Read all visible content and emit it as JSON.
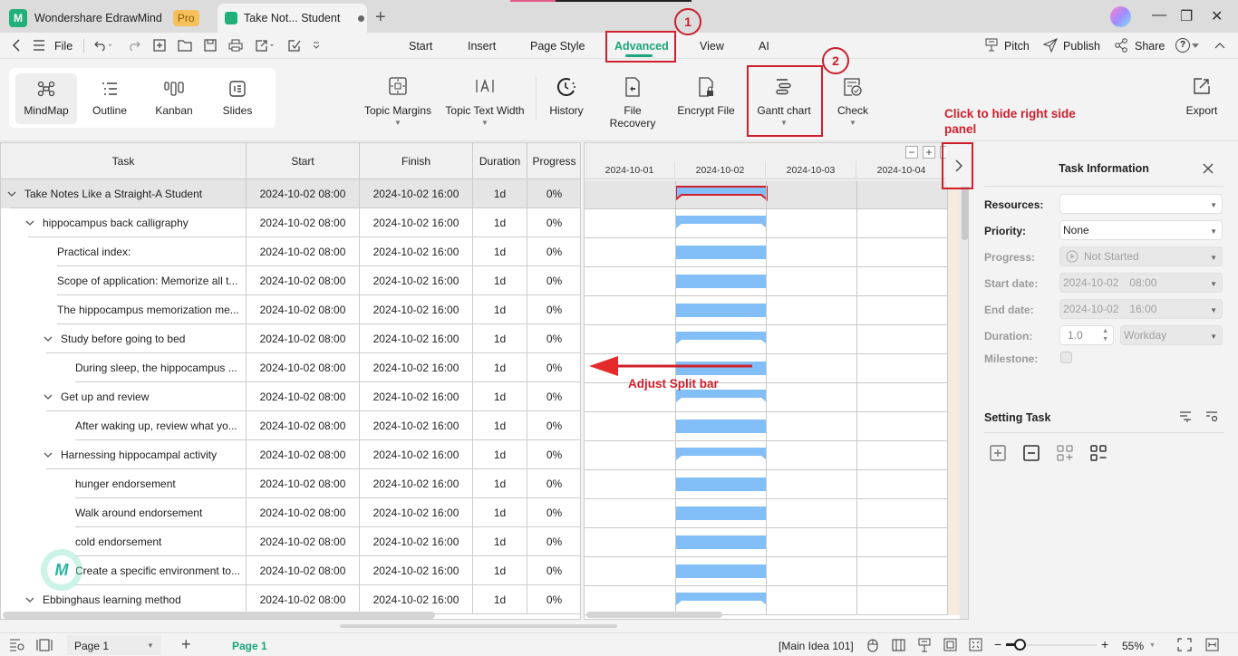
{
  "titlebar": {
    "app_tab_label": "Wondershare EdrawMind",
    "pro_badge": "Pro",
    "doc_tab_label": "Take Not... Student",
    "new_tab": "+",
    "minimize": "—",
    "restore": "❐",
    "close": "✕"
  },
  "menubar": {
    "file": "File",
    "tabs": [
      "Start",
      "Insert",
      "Page Style",
      "Advanced",
      "View",
      "AI"
    ],
    "active_tab": "Advanced",
    "pitch": "Pitch",
    "publish": "Publish",
    "share": "Share",
    "help": "?",
    "collapse": "^"
  },
  "ribbon": {
    "views": [
      {
        "label": "MindMap",
        "icon": "mindmap-icon",
        "active": true
      },
      {
        "label": "Outline",
        "icon": "outline-icon",
        "active": false
      },
      {
        "label": "Kanban",
        "icon": "kanban-icon",
        "active": false
      },
      {
        "label": "Slides",
        "icon": "slides-icon",
        "active": false
      }
    ],
    "topic_margins": "Topic Margins",
    "topic_text_width": "Topic Text Width",
    "history": "History",
    "file_recovery": "File Recovery",
    "encrypt_file": "Encrypt File",
    "gantt_chart": "Gantt chart",
    "check": "Check",
    "export": "Export"
  },
  "annotations": {
    "step1": "1",
    "step2": "2",
    "hide_panel": "Click to hide right side panel",
    "adjust_split": "Adjust Split bar",
    "color": "#d0202c"
  },
  "grid": {
    "headers": {
      "task": "Task",
      "start": "Start",
      "finish": "Finish",
      "duration": "Duration",
      "progress": "Progress"
    },
    "rows": [
      {
        "task": "Take Notes Like a Straight-A Student",
        "level": 0,
        "expandable": true,
        "start": "2024-10-02 08:00",
        "finish": "2024-10-02 16:00",
        "duration": "1d",
        "progress": "0%",
        "selected": true
      },
      {
        "task": "hippocampus back calligraphy",
        "level": 1,
        "expandable": true,
        "start": "2024-10-02 08:00",
        "finish": "2024-10-02 16:00",
        "duration": "1d",
        "progress": "0%"
      },
      {
        "task": "Practical index:",
        "level": 2,
        "expandable": false,
        "start": "2024-10-02 08:00",
        "finish": "2024-10-02 16:00",
        "duration": "1d",
        "progress": "0%"
      },
      {
        "task": "Scope of application: Memorize all t...",
        "level": 2,
        "expandable": false,
        "start": "2024-10-02 08:00",
        "finish": "2024-10-02 16:00",
        "duration": "1d",
        "progress": "0%"
      },
      {
        "task": "The hippocampus memorization me...",
        "level": 2,
        "expandable": false,
        "start": "2024-10-02 08:00",
        "finish": "2024-10-02 16:00",
        "duration": "1d",
        "progress": "0%"
      },
      {
        "task": "Study before going to bed",
        "level": 2,
        "expandable": true,
        "start": "2024-10-02 08:00",
        "finish": "2024-10-02 16:00",
        "duration": "1d",
        "progress": "0%"
      },
      {
        "task": "During sleep, the hippocampus ...",
        "level": 3,
        "expandable": false,
        "start": "2024-10-02 08:00",
        "finish": "2024-10-02 16:00",
        "duration": "1d",
        "progress": "0%"
      },
      {
        "task": "Get up and review",
        "level": 2,
        "expandable": true,
        "start": "2024-10-02 08:00",
        "finish": "2024-10-02 16:00",
        "duration": "1d",
        "progress": "0%"
      },
      {
        "task": "After waking up, review what yo...",
        "level": 3,
        "expandable": false,
        "start": "2024-10-02 08:00",
        "finish": "2024-10-02 16:00",
        "duration": "1d",
        "progress": "0%"
      },
      {
        "task": "Harnessing hippocampal activity",
        "level": 2,
        "expandable": true,
        "start": "2024-10-02 08:00",
        "finish": "2024-10-02 16:00",
        "duration": "1d",
        "progress": "0%"
      },
      {
        "task": "hunger endorsement",
        "level": 3,
        "expandable": false,
        "start": "2024-10-02 08:00",
        "finish": "2024-10-02 16:00",
        "duration": "1d",
        "progress": "0%"
      },
      {
        "task": "Walk around endorsement",
        "level": 3,
        "expandable": false,
        "start": "2024-10-02 08:00",
        "finish": "2024-10-02 16:00",
        "duration": "1d",
        "progress": "0%"
      },
      {
        "task": "cold endorsement",
        "level": 3,
        "expandable": false,
        "start": "2024-10-02 08:00",
        "finish": "2024-10-02 16:00",
        "duration": "1d",
        "progress": "0%"
      },
      {
        "task": "Create a specific environment to...",
        "level": 3,
        "expandable": false,
        "start": "2024-10-02 08:00",
        "finish": "2024-10-02 16:00",
        "duration": "1d",
        "progress": "0%"
      },
      {
        "task": "Ebbinghaus learning method",
        "level": 1,
        "expandable": true,
        "start": "2024-10-02 08:00",
        "finish": "2024-10-02 16:00",
        "duration": "1d",
        "progress": "0%"
      }
    ]
  },
  "gantt": {
    "dates": [
      "2024-10-01",
      "2024-10-02",
      "2024-10-03",
      "2024-10-04"
    ],
    "zoom_out": "−",
    "zoom_in": "+",
    "bar_color": "#82bff8",
    "bar_start_day": "2024-10-02",
    "bar_days": 1
  },
  "right_panel": {
    "title": "Task Information",
    "resources_label": "Resources:",
    "resources_value": "",
    "priority_label": "Priority:",
    "priority_value": "None",
    "progress_label": "Progress:",
    "progress_value": "Not Started",
    "start_label": "Start date:",
    "start_date": "2024-10-02",
    "start_time": "08:00",
    "end_label": "End date:",
    "end_date": "2024-10-02",
    "end_time": "16:00",
    "duration_label": "Duration:",
    "duration_value": "1.0",
    "duration_unit": "Workday",
    "milestone_label": "Milestone:",
    "milestone_checked": false,
    "setting_title": "Setting Task"
  },
  "statusbar": {
    "page_select": "Page 1",
    "add_page": "+",
    "active_page": "Page 1",
    "main_idea": "[Main Idea 101]",
    "zoom_minus": "−",
    "zoom_plus": "+",
    "zoom_level": "55%"
  }
}
